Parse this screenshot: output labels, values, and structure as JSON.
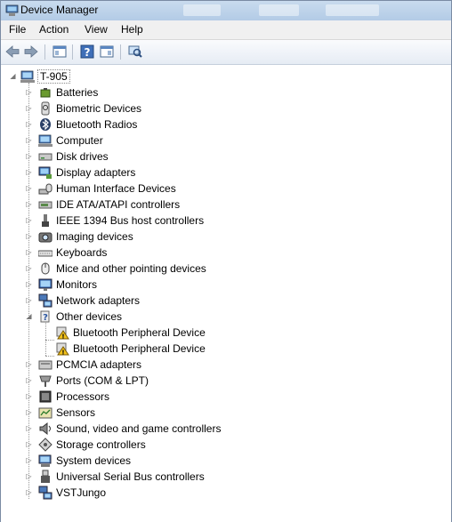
{
  "window": {
    "title": "Device Manager"
  },
  "menu": [
    {
      "label": "File",
      "name": "menu-file"
    },
    {
      "label": "Action",
      "name": "menu-action"
    },
    {
      "label": "View",
      "name": "menu-view"
    },
    {
      "label": "Help",
      "name": "menu-help"
    }
  ],
  "toolbar": [
    {
      "name": "back-button",
      "icon": "back-arrow-icon"
    },
    {
      "name": "forward-button",
      "icon": "forward-arrow-icon"
    },
    {
      "name": "show-hide-console-tree-button",
      "icon": "console-tree-icon"
    },
    {
      "name": "help-button",
      "icon": "help-icon"
    },
    {
      "name": "show-action-pane-button",
      "icon": "action-pane-icon"
    },
    {
      "name": "scan-hardware-changes-button",
      "icon": "scan-hardware-icon"
    }
  ],
  "tree": {
    "root": {
      "label": "T-905",
      "icon": "computer-icon",
      "expanded": true
    },
    "items": [
      {
        "label": "Batteries",
        "icon": "battery-icon",
        "expanded": false
      },
      {
        "label": "Biometric Devices",
        "icon": "biometric-icon",
        "expanded": false
      },
      {
        "label": "Bluetooth Radios",
        "icon": "bluetooth-icon",
        "expanded": false
      },
      {
        "label": "Computer",
        "icon": "computer-icon",
        "expanded": false
      },
      {
        "label": "Disk drives",
        "icon": "disk-drive-icon",
        "expanded": false
      },
      {
        "label": "Display adapters",
        "icon": "display-adapter-icon",
        "expanded": false
      },
      {
        "label": "Human Interface Devices",
        "icon": "hid-icon",
        "expanded": false
      },
      {
        "label": "IDE ATA/ATAPI controllers",
        "icon": "ide-controller-icon",
        "expanded": false
      },
      {
        "label": "IEEE 1394 Bus host controllers",
        "icon": "ieee1394-icon",
        "expanded": false
      },
      {
        "label": "Imaging devices",
        "icon": "camera-icon",
        "expanded": false
      },
      {
        "label": "Keyboards",
        "icon": "keyboard-icon",
        "expanded": false
      },
      {
        "label": "Mice and other pointing devices",
        "icon": "mouse-icon",
        "expanded": false
      },
      {
        "label": "Monitors",
        "icon": "monitor-icon",
        "expanded": false
      },
      {
        "label": "Network adapters",
        "icon": "network-adapter-icon",
        "expanded": false
      },
      {
        "label": "Other devices",
        "icon": "unknown-device-icon",
        "expanded": true,
        "children": [
          {
            "label": "Bluetooth Peripheral Device",
            "icon": "warning-device-icon"
          },
          {
            "label": "Bluetooth Peripheral Device",
            "icon": "warning-device-icon"
          }
        ]
      },
      {
        "label": "PCMCIA adapters",
        "icon": "pcmcia-icon",
        "expanded": false
      },
      {
        "label": "Ports (COM & LPT)",
        "icon": "port-icon",
        "expanded": false
      },
      {
        "label": "Processors",
        "icon": "processor-icon",
        "expanded": false
      },
      {
        "label": "Sensors",
        "icon": "sensor-icon",
        "expanded": false
      },
      {
        "label": "Sound, video and game controllers",
        "icon": "speaker-icon",
        "expanded": false
      },
      {
        "label": "Storage controllers",
        "icon": "storage-controller-icon",
        "expanded": false
      },
      {
        "label": "System devices",
        "icon": "system-device-icon",
        "expanded": false
      },
      {
        "label": "Universal Serial Bus controllers",
        "icon": "usb-icon",
        "expanded": false
      },
      {
        "label": "VSTJungo",
        "icon": "network-adapter-icon",
        "expanded": false
      }
    ]
  }
}
